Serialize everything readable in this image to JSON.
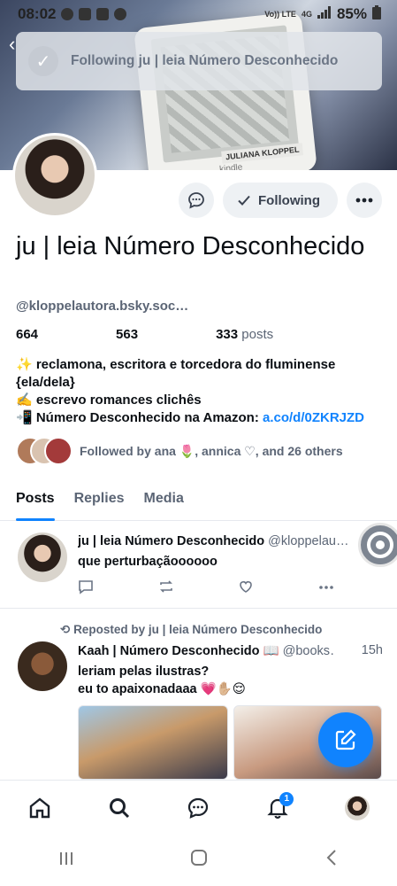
{
  "status_bar": {
    "time": "08:02",
    "signal_label": "Vo)) LTE",
    "net": "4G",
    "battery": "85%"
  },
  "banner": {
    "book_author": "JULIANA KLOPPEL",
    "device_brand": "kindle"
  },
  "toast": {
    "message": "Following ju | leia Número Desconhecido"
  },
  "profile": {
    "display_name": "ju | leia Número Desconhecido",
    "handle": "@kloppelautora.bsky.soc…",
    "followers": "664",
    "following": "563",
    "posts_count": "333",
    "posts_label": "posts",
    "follow_button": "Following",
    "bio_line1": "✨ reclamona, escritora e torcedora do fluminense {ela/dela}",
    "bio_line2": "✍️ escrevo romances clichês",
    "bio_line3_text": "📲 Número Desconhecido na Amazon: ",
    "bio_line3_link": "a.co/d/0ZKRJZD",
    "followed_by": "Followed by ana 🌷, annica ♡, and 26 others"
  },
  "tabs": [
    "Posts",
    "Replies",
    "Media"
  ],
  "posts": [
    {
      "author": "ju | leia Número Desconhecido",
      "handle": "@kloppelau…",
      "text": "que perturbaçãoooooo"
    },
    {
      "repost_label": "Reposted by ju | leia Número Desconhecido",
      "author": "Kaah | Número Desconhecido 📖",
      "handle": "@books…",
      "time": "15h",
      "text_line1": "leriam pelas ilustras?",
      "text_line2": "eu to apaixonadaaa 💗✋🏼😌"
    }
  ],
  "notifications_badge": "1",
  "colors": {
    "accent": "#1083fe",
    "muted": "#5b6575"
  }
}
